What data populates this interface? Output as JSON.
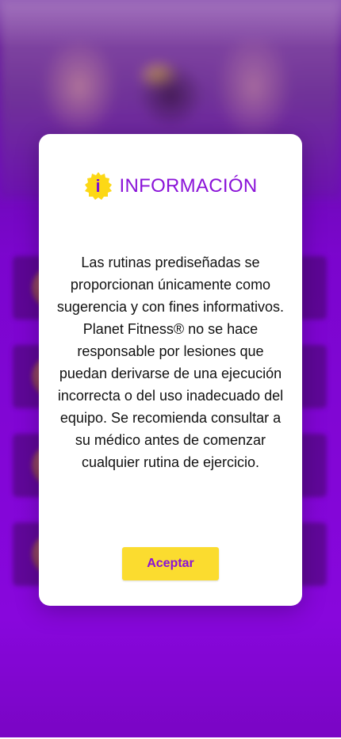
{
  "modal": {
    "icon": "info-icon",
    "icon_letter": "i",
    "title": "INFORMACIÓN",
    "body": "Las rutinas prediseñadas se proporcionan únicamente como sugerencia y con fines informativos. Planet Fitness® no se hace responsable por lesiones que puedan derivarse de una ejecución incorrecta o del uso inadecuado del equipo. Se recomienda consultar a su médico antes de comenzar cualquier rutina de ejercicio.",
    "accept_label": "Aceptar"
  },
  "colors": {
    "accent_purple": "#8a12d8",
    "button_yellow": "#fbdc2f",
    "background_purple": "#7c06d0"
  }
}
